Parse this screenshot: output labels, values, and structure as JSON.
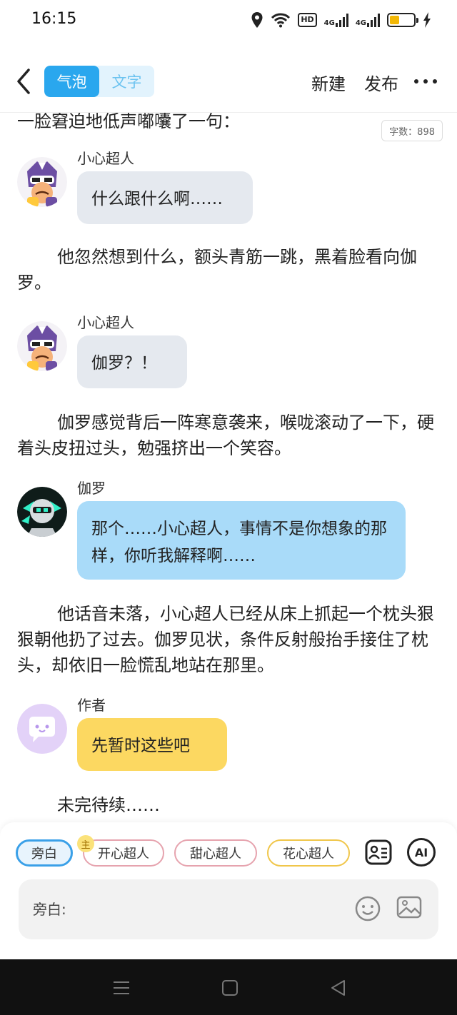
{
  "status_bar": {
    "time": "16:15",
    "hd_label": "HD",
    "net1": "4G",
    "net2": "4G",
    "battery_level": 0.4,
    "battery_color": "#f2b705"
  },
  "header": {
    "tabs": [
      {
        "label": "气泡",
        "active": true
      },
      {
        "label": "文字",
        "active": false
      }
    ],
    "new_label": "新建",
    "publish_label": "发布",
    "accent": "#2aa7ee"
  },
  "content": {
    "cut_line": "一脸窘迫地低声嘟囔了一句：",
    "word_count": "字数：898",
    "messages": [
      {
        "name": "小心超人",
        "text": "什么跟什么啊……",
        "bubble_color": "#e5e9ef"
      },
      {
        "name": "小心超人",
        "text": "伽罗？！",
        "bubble_color": "#e5e9ef"
      },
      {
        "name": "伽罗",
        "text": "那个……小心超人，事情不是你想象的那样，你听我解释啊……",
        "bubble_color": "#a9dbf9"
      },
      {
        "name": "作者",
        "text": "先暂时这些吧",
        "bubble_color": "#fcd861"
      }
    ],
    "narrations": [
      "他忽然想到什么，额头青筋一跳，黑着脸看向伽罗。",
      "伽罗感觉背后一阵寒意袭来，喉咙滚动了一下，硬着头皮扭过头，勉强挤出一个笑容。",
      "他话音未落，小心超人已经从床上抓起一个枕头狠狠朝他扔了过去。伽罗见状，条件反射般抬手接住了枕头，却依旧一脸慌乱地站在那里。",
      "未完待续……"
    ]
  },
  "panel": {
    "chips": [
      "旁白",
      "开心超人",
      "甜心超人",
      "花心超人"
    ],
    "main_badge": "主",
    "ai_label": "AI",
    "input_placeholder": "旁白:",
    "icons": [
      "contact-card-icon",
      "emoji-icon",
      "image-icon"
    ]
  },
  "navbar": {
    "icons": [
      "menu-icon",
      "home-icon",
      "back-icon"
    ]
  }
}
